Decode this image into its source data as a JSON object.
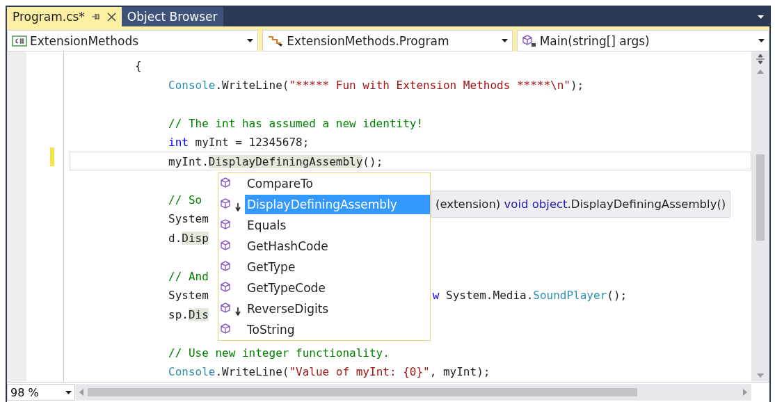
{
  "tabs": [
    {
      "label": "Program.cs*",
      "selected": true,
      "pinnable": true
    },
    {
      "label": "Object Browser",
      "selected": false,
      "pinnable": false
    }
  ],
  "navigation": [
    {
      "kind": "project",
      "label": "ExtensionMethods"
    },
    {
      "kind": "class",
      "label": "ExtensionMethods.Program"
    },
    {
      "kind": "member",
      "label": "Main(string[] args)"
    }
  ],
  "code_lines": [
    {
      "current": false,
      "tokens": [
        {
          "kind": "plain",
          "text": "{"
        }
      ],
      "children": [
        {
          "current": false,
          "tokens": [
            {
              "kind": "type",
              "text": "Console"
            },
            {
              "kind": "plain",
              "text": ".WriteLine("
            },
            {
              "kind": "string",
              "text": "\"***** Fun with Extension Methods *****\\n\""
            },
            {
              "kind": "plain",
              "text": ");"
            }
          ]
        },
        {
          "current": false
        },
        {
          "current": false,
          "tokens": [
            {
              "kind": "comment",
              "text": "// The int has assumed a new identity!"
            }
          ]
        },
        {
          "current": false,
          "tokens": [
            {
              "kind": "keyword",
              "text": "int"
            },
            {
              "kind": "plain",
              "text": " myInt = 12345678;"
            }
          ]
        },
        {
          "current": true,
          "tokens": [
            {
              "kind": "plain",
              "text": "myInt."
            },
            {
              "kind": "reference",
              "text": "DisplayDefiningAssembly"
            },
            {
              "kind": "plain",
              "text": "();"
            }
          ]
        },
        {
          "current": false
        },
        {
          "current": false,
          "tokens": [
            {
              "kind": "comment",
              "text": "// So"
            }
          ]
        },
        {
          "current": false,
          "tokens": [
            {
              "kind": "plain",
              "text": "System"
            }
          ]
        },
        {
          "current": false,
          "tokens": [
            {
              "kind": "plain",
              "text": "d."
            },
            {
              "kind": "reference",
              "text": "Disp"
            }
          ]
        },
        {
          "current": false
        },
        {
          "current": false,
          "tokens": [
            {
              "kind": "comment",
              "text": "// And"
            }
          ]
        },
        {
          "current": false,
          "tokens": [
            {
              "kind": "plain",
              "text": "System"
            },
            {
              "kind": "covered"
            },
            {
              "kind": "keyword",
              "text": "w"
            },
            {
              "kind": "plain",
              "text": " System.Media."
            },
            {
              "kind": "type",
              "text": "SoundPlayer"
            },
            {
              "kind": "plain",
              "text": "();"
            }
          ]
        },
        {
          "current": false,
          "tokens": [
            {
              "kind": "plain",
              "text": "sp."
            },
            {
              "kind": "reference",
              "text": "Dis"
            }
          ]
        },
        {
          "current": false
        },
        {
          "current": false,
          "tokens": [
            {
              "kind": "comment",
              "text": "// Use new integer functionality."
            }
          ]
        },
        {
          "current": false,
          "tokens": [
            {
              "kind": "type",
              "text": "Console"
            },
            {
              "kind": "plain",
              "text": ".WriteLine("
            },
            {
              "kind": "string",
              "text": "\"Value of myInt: {0}\""
            },
            {
              "kind": "plain",
              "text": ", myInt);"
            }
          ]
        }
      ]
    }
  ],
  "completion_list": [
    {
      "kind": "method",
      "label": "CompareTo",
      "selected": false
    },
    {
      "kind": "extension",
      "label": "DisplayDefiningAssembly",
      "selected": true
    },
    {
      "kind": "method",
      "label": "Equals",
      "selected": false
    },
    {
      "kind": "method",
      "label": "GetHashCode",
      "selected": false
    },
    {
      "kind": "method",
      "label": "GetType",
      "selected": false
    },
    {
      "kind": "method",
      "label": "GetTypeCode",
      "selected": false
    },
    {
      "kind": "extension",
      "label": "ReverseDigits",
      "selected": false
    },
    {
      "kind": "method",
      "label": "ToString",
      "selected": false
    }
  ],
  "tooltip": [
    {
      "kind": "plain",
      "text": "(extension) "
    },
    {
      "kind": "keyword",
      "text": "void object"
    },
    {
      "kind": "plain",
      "text": ".DisplayDefiningAssembly()"
    }
  ],
  "zoom": "98 %"
}
